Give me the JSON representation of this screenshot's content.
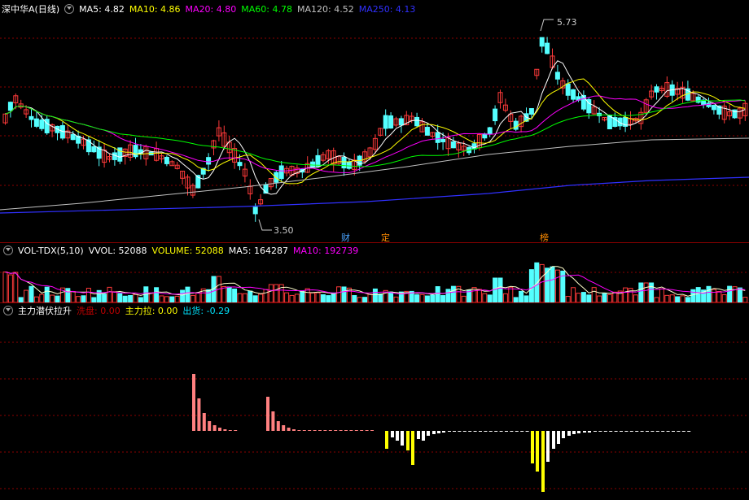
{
  "main": {
    "title": "深中华A(日线)",
    "ma": [
      {
        "label": "MA5: 4.82",
        "color": "#ffffff"
      },
      {
        "label": "MA10: 4.86",
        "color": "#ffff00"
      },
      {
        "label": "MA20: 4.80",
        "color": "#ff00ff"
      },
      {
        "label": "MA60: 4.78",
        "color": "#00ff00"
      },
      {
        "label": "MA120: 4.52",
        "color": "#c0c0c0"
      },
      {
        "label": "MA250: 4.13",
        "color": "#3030ff"
      }
    ],
    "high_label": "5.73",
    "low_label": "3.50",
    "markers": [
      {
        "text": "财",
        "color": "#4aa3ff"
      },
      {
        "text": "定",
        "color": "#ff8c00"
      },
      {
        "text": "榜",
        "color": "#ff8c00"
      }
    ]
  },
  "volume": {
    "title": "VOL-TDX(5,10)",
    "items": [
      {
        "label": "VVOL: 52088",
        "color": "#ffffff"
      },
      {
        "label": "VOLUME: 52088",
        "color": "#ffff00"
      },
      {
        "label": "MA5: 164287",
        "color": "#ffffff"
      },
      {
        "label": "MA10: 192739",
        "color": "#ff00ff"
      }
    ]
  },
  "indicator": {
    "title": "主力潜伏拉升",
    "items": [
      {
        "label": "洗盘: 0.00",
        "color": "#c00000"
      },
      {
        "label": "主力拉: 0.00",
        "color": "#ffff00"
      },
      {
        "label": "出货: -0.29",
        "color": "#00e5ff"
      }
    ]
  },
  "colors": {
    "up": "#ff3a3a",
    "down": "#54ffff",
    "grid": "#8b0000"
  }
}
